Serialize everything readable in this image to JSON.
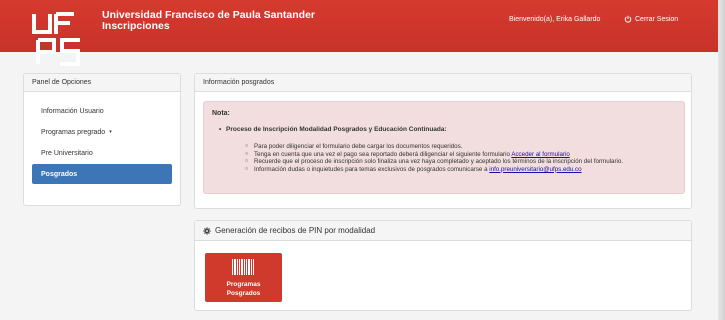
{
  "header": {
    "logo_text": "UFPS",
    "title": "Universidad Francisco de Paula Santander",
    "subtitle": "Inscripciones",
    "welcome": "Bienvenido(a), Erika Gallardo",
    "logout": "Cerrar Sesion",
    "logout_icon": "power-icon",
    "brand_color": "#c8322a"
  },
  "sidebar": {
    "title": "Panel de Opciones",
    "items": [
      {
        "label": "Información Usuario"
      },
      {
        "label": "Programas pregrado",
        "caret": "▾"
      },
      {
        "label": "Pre Universitario"
      },
      {
        "label": "Posgrados"
      }
    ],
    "active_color": "#3d76b7"
  },
  "info_panel": {
    "title": "Información posgrados",
    "nota": "Nota:",
    "bullet": "Proceso de Inscripción Modalidad Posgrados y Educación Continuada:",
    "items": [
      {
        "text": "Para poder diligenciar el formulario debe cargar los documentos requeridos."
      },
      {
        "text": "Tenga en cuenta que una vez el pago sea reportado deberá diligenciar el siguiente formulario ",
        "link": "Acceder al formulario"
      },
      {
        "text": "Recuerde que el proceso de inscripción solo finaliza una vez haya completado y aceptado los términos de la inscripción del formulario."
      },
      {
        "text": "Información dudas o inquietudes para temas exclusivos de posgrados comunicarse a ",
        "link": "info.preuniversitario@ufps.edu.co"
      }
    ]
  },
  "generation_panel": {
    "title": "Generación de recibos de PIN por modalidad",
    "icon": "gear-icon",
    "button": {
      "line1": "Programas",
      "line2": "Posgrados",
      "icon": "barcode-icon"
    }
  }
}
